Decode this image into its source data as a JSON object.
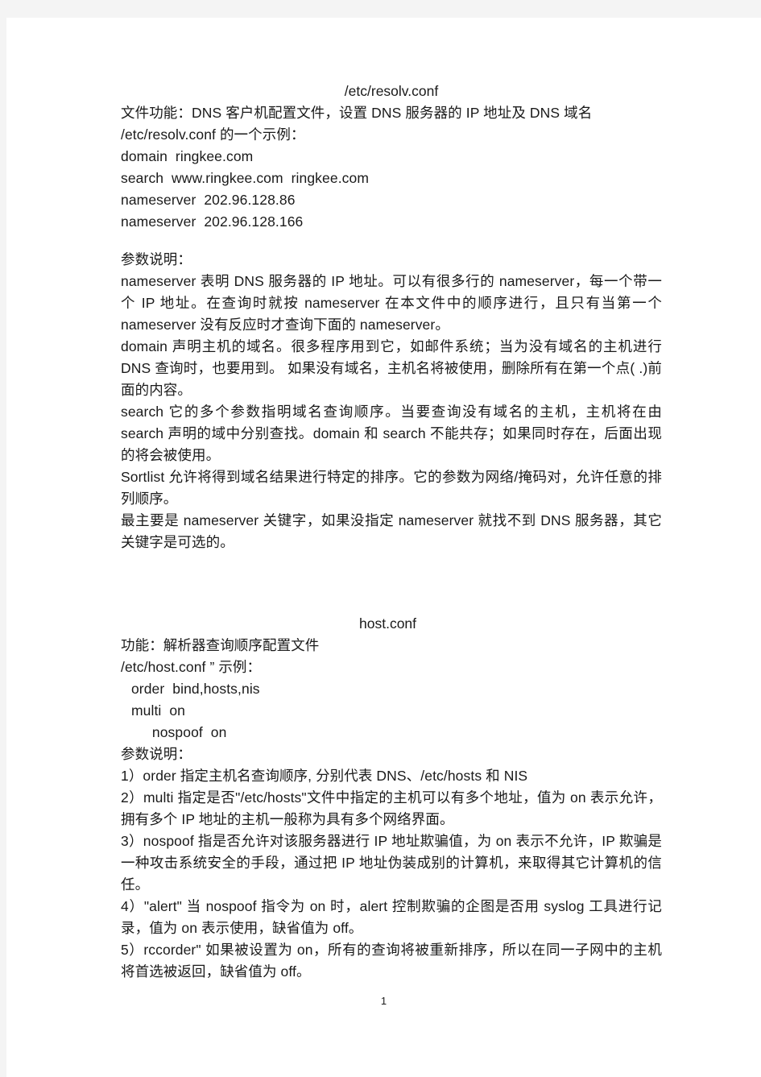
{
  "document": {
    "page_number": "1",
    "sections": [
      {
        "id": "resolv-conf",
        "title": "/etc/resolv.conf",
        "title_align": "center",
        "lines": [
          "文件功能：DNS 客户机配置文件，设置 DNS 服务器的 IP 地址及 DNS 域名",
          "/etc/resolv.conf 的一个示例：",
          "domain  ringkee.com",
          "search  www.ringkee.com  ringkee.com",
          "nameserver  202.96.128.86",
          "nameserver  202.96.128.166"
        ],
        "params_heading": "参数说明：",
        "paragraphs": [
          "nameserver    表明 DNS 服务器的 IP 地址。可以有很多行的 nameserver，每一个带一个 IP 地址。在查询时就按 nameserver 在本文件中的顺序进行，且只有当第一个 nameserver 没有反应时才查询下面的 nameserver。",
          "domain    声明主机的域名。很多程序用到它，如邮件系统；当为没有域名的主机进行 DNS 查询时，也要用到。 如果没有域名，主机名将被使用，删除所有在第一个点( .)前面的内容。",
          "search    它的多个参数指明域名查询顺序。当要查询没有域名的主机，主机将在由 search 声明的域中分别查找。domain 和 search 不能共存；如果同时存在，后面出现的将会被使用。",
          "Sortlist    允许将得到域名结果进行特定的排序。它的参数为网络/掩码对，允许任意的排列顺序。",
          "最主要是 nameserver 关键字，如果没指定 nameserver 就找不到 DNS 服务器，其它关键字是可选的。"
        ]
      },
      {
        "id": "host-conf",
        "title": "host.conf",
        "title_align": "indented",
        "lines": [
          "功能：解析器查询顺序配置文件",
          "/etc/host.conf ” 示例：",
          " order  bind,hosts,nis",
          " multi  on",
          "   nospoof  on"
        ],
        "params_heading": "参数说明：",
        "paragraphs": [
          "1）order  指定主机名查询顺序, 分别代表 DNS、/etc/hosts  和 NIS",
          "2）multi  指定是否\"/etc/hosts\"文件中指定的主机可以有多个地址，值为 on  表示允许，拥有多个 IP  地址的主机一般称为具有多个网络界面。",
          "3）nospoof  指是否允许对该服务器进行 IP  地址欺骗值，为 on  表示不允许，IP 欺骗是一种攻击系统安全的手段，通过把 IP  地址伪装成别的计算机，来取得其它计算机的信任。",
          "4）\"alert\"  当 nospoof  指令为 on  时，alert  控制欺骗的企图是否用 syslog  工具进行记录，值为 on  表示使用，缺省值为 off。",
          "5）rccorder\"  如果被设置为 on，所有的查询将被重新排序，所以在同一子网中的主机将首选被返回，缺省值为 off。"
        ]
      }
    ]
  }
}
